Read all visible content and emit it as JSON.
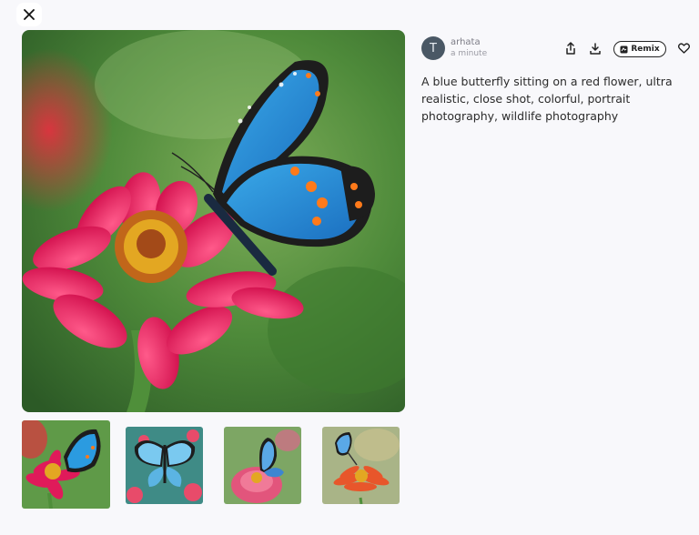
{
  "close_button": {
    "icon": "close-icon"
  },
  "main_image": {
    "description_icon": "butterfly-photo"
  },
  "thumbnails": [
    {
      "selected": true
    },
    {
      "selected": false
    },
    {
      "selected": false
    },
    {
      "selected": false
    }
  ],
  "author": {
    "avatar_letter": "T",
    "name": "arhata",
    "time": "a minute"
  },
  "actions": {
    "share_icon": "share-icon",
    "download_icon": "download-icon",
    "remix_label": "Remix",
    "like_icon": "heart-icon"
  },
  "prompt": "A blue butterfly sitting on a red flower, ultra realistic, close shot, colorful, portrait photography, wildlife photography",
  "colors": {
    "accent": "#4a5865",
    "background": "#f8f8fb"
  }
}
